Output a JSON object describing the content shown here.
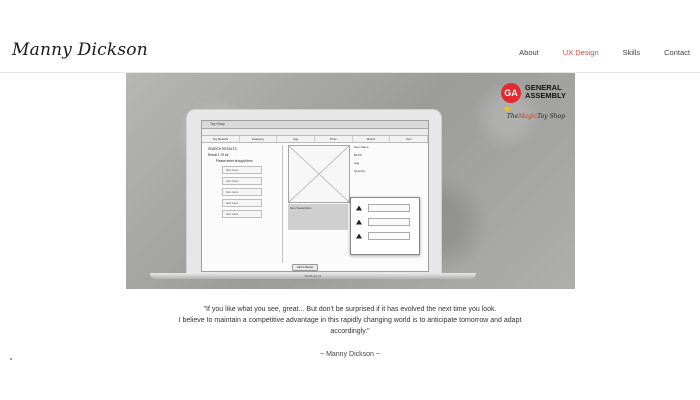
{
  "header": {
    "logo_text": "Manny Dickson",
    "nav": [
      {
        "label": "About",
        "active": false
      },
      {
        "label": "UX Design",
        "active": true
      },
      {
        "label": "Skills",
        "active": false
      },
      {
        "label": "Contact",
        "active": false
      }
    ],
    "active_color": "#e8453c"
  },
  "hero": {
    "screen": {
      "tab_title": "Toy Shop",
      "menu_items": [
        "Toy Results",
        "Category",
        "Age",
        "Price",
        "Brand",
        "Sort"
      ],
      "sidebar_title": "SEARCH RESULTS",
      "sidebar_sub": "Result 1 Of ##",
      "sidebar_note": "Please enter brought item",
      "sidebar_items": [
        "Item name",
        "Item name",
        "Item name",
        "Item name",
        "Item name"
      ],
      "details": [
        "Item Name",
        "$0.00",
        "Age",
        "Quantity"
      ],
      "caption": "Item Description",
      "add_button": "Add to Basket",
      "popup_rows": 3
    },
    "laptop_label": "MacBook Air",
    "brand": {
      "ga_badge": "GA",
      "ga_line1": "GENERAL",
      "ga_line2": "ASSEMBLY",
      "shop_prefix": "The",
      "shop_magic": "Magic",
      "shop_suffix": "Toy Shop"
    }
  },
  "quote": {
    "line1": "\"If you like what you see, great... But don't be surprised if it has evolved the next time you look.",
    "line2": "I believe to maintain a competitive advantage in this rapidly changing world is to anticipate tomorrow and adapt",
    "line3": "accordingly.\"",
    "author": "~ Manny Dickson ~"
  }
}
